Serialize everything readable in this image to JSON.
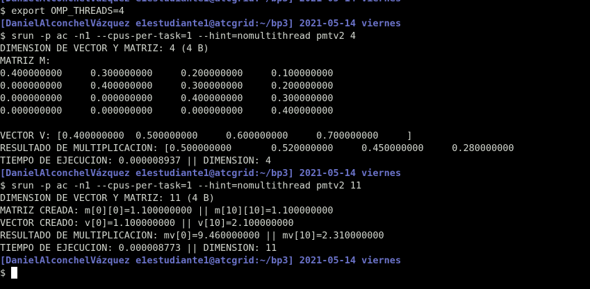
{
  "terminal": {
    "prompt_text": "[DanielAlconchelVázquez e1estudiante1@atcgrid:~/bp3] 2021-05-14 viernes",
    "command_symbol": "$ ",
    "commands": {
      "export": "export OMP_THREADS=4",
      "run4": "srun -p ac -n1 --cpus-per-task=1 --hint=nomultithread pmtv2 4",
      "run11": "srun -p ac -n1 --cpus-per-task=1 --hint=nomultithread pmtv2 11"
    },
    "run4": {
      "dimension": "DIMENSION DE VECTOR Y MATRIZ: 4 (4 B)",
      "matrix_label": "MATRIZ M:",
      "matrix_rows": [
        "0.400000000     0.300000000     0.200000000     0.100000000",
        "0.000000000     0.400000000     0.300000000     0.200000000",
        "0.000000000     0.000000000     0.400000000     0.300000000",
        "0.000000000     0.000000000     0.000000000     0.400000000"
      ],
      "vector": "VECTOR V: [0.400000000  0.500000000     0.600000000     0.700000000     ]",
      "result": "RESULTADO DE MULTIPLICACION: [0.500000000       0.520000000     0.450000000     0.280000000",
      "time": "TIEMPO DE EJECUCION: 0.000008937 || DIMENSION: 4"
    },
    "run11": {
      "dimension": "DIMENSION DE VECTOR Y MATRIZ: 11 (4 B)",
      "matrix_created": "MATRIZ CREADA: m[0][0]=1.100000000 || m[10][10]=1.100000000",
      "vector_created": "VECTOR CREADO: v[0]=1.100000000 || v[10]=2.100000000",
      "result": "RESULTADO DE MULTIPLICACION: mv[0]=9.460000000 || mv[10]=2.310000000",
      "time": "TIEMPO DE EJECUCION: 0.000008773 || DIMENSION: 11"
    }
  },
  "colors": {
    "background": "#000000",
    "text": "#d3d7cf",
    "prompt": "#6b73c9",
    "cursor": "#ffffff"
  }
}
